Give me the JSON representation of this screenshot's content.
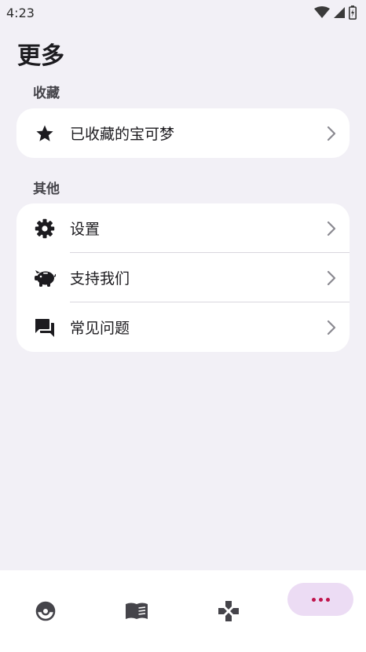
{
  "status_bar": {
    "time": "4:23"
  },
  "page": {
    "title": "更多"
  },
  "sections": {
    "favorites": {
      "label": "收藏",
      "items": [
        {
          "label": "已收藏的宝可梦",
          "icon": "star-icon"
        }
      ]
    },
    "other": {
      "label": "其他",
      "items": [
        {
          "label": "设置",
          "icon": "gear-icon"
        },
        {
          "label": "支持我们",
          "icon": "piggy-bank-icon"
        },
        {
          "label": "常见问题",
          "icon": "chat-bubbles-icon"
        }
      ]
    }
  },
  "bottom_nav": {
    "items": [
      {
        "icon": "pokeball-icon"
      },
      {
        "icon": "book-icon"
      },
      {
        "icon": "gamepad-icon"
      },
      {
        "icon": "more-dots-icon",
        "active": true
      }
    ],
    "active_color": "#c0144c",
    "active_pill_color": "#ecdcf4"
  }
}
